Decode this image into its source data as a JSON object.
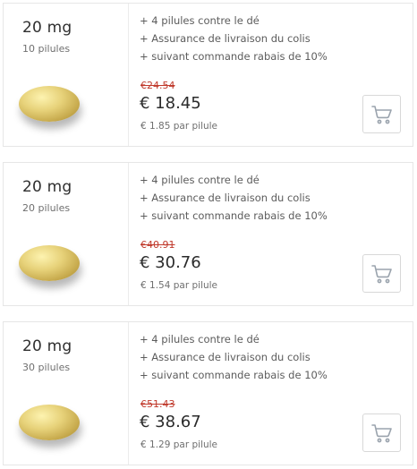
{
  "products": [
    {
      "dose": "20 mg",
      "quantity": "10 pilules",
      "features": [
        "+ 4 pilules contre le dé",
        "+ Assurance de livraison du colis",
        "+ suivant commande rabais de 10%"
      ],
      "old_price": "€24.54",
      "price": "€ 18.45",
      "per_pill": "€ 1.85 par pilule"
    },
    {
      "dose": "20 mg",
      "quantity": "20 pilules",
      "features": [
        "+ 4 pilules contre le dé",
        "+ Assurance de livraison du colis",
        "+ suivant commande rabais de 10%"
      ],
      "old_price": "€40.91",
      "price": "€ 30.76",
      "per_pill": "€ 1.54 par pilule"
    },
    {
      "dose": "20 mg",
      "quantity": "30 pilules",
      "features": [
        "+ 4 pilules contre le dé",
        "+ Assurance de livraison du colis",
        "+ suivant commande rabais de 10%"
      ],
      "old_price": "€51.43",
      "price": "€ 38.67",
      "per_pill": "€ 1.29 par pilule"
    }
  ],
  "icons": {
    "cart": "shopping-cart-icon",
    "pill": "pill-image"
  },
  "colors": {
    "old_price": "#c0392b",
    "cart_icon": "#9aa3ad",
    "border": "#e6e6e6"
  }
}
